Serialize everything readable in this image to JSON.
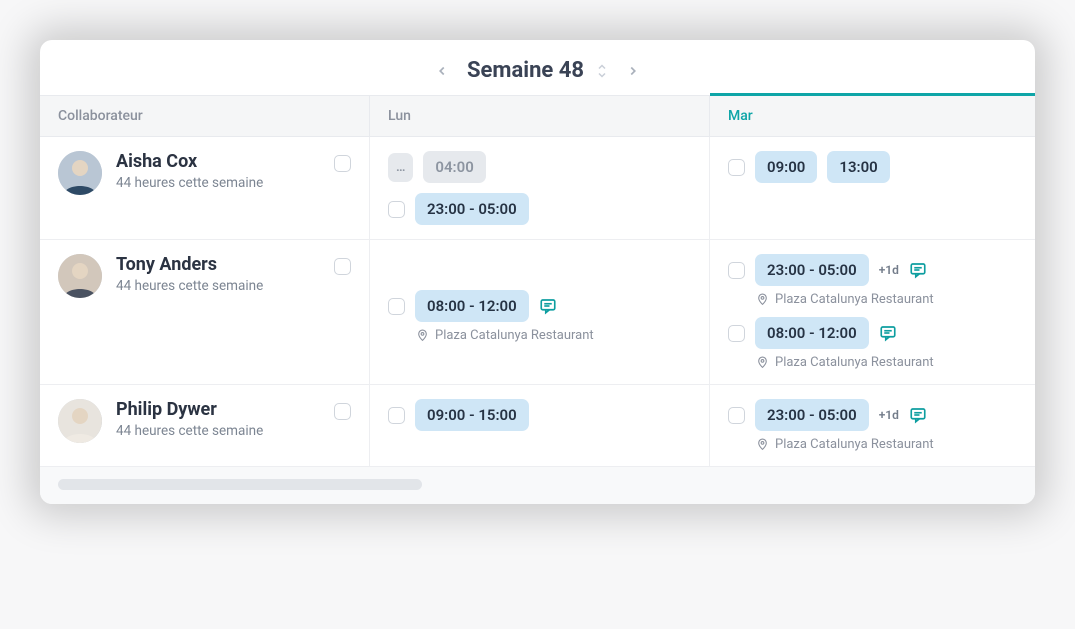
{
  "header": {
    "title": "Semaine 48"
  },
  "columns": {
    "collab": "Collaborateur",
    "mon": "Lun",
    "tue": "Mar"
  },
  "rows": [
    {
      "name": "Aisha Cox",
      "sub": "44 heures cette semaine",
      "mon": [
        {
          "ellipsis": "…",
          "time": "04:00",
          "muted": true
        },
        {
          "check": true,
          "time": "23:00 - 05:00"
        }
      ],
      "tue": [
        {
          "check": true,
          "time1": "09:00",
          "time2": "13:00"
        }
      ]
    },
    {
      "name": "Tony Anders",
      "sub": "44 heures cette semaine",
      "mon": [
        {
          "check": true,
          "time": "08:00 - 12:00",
          "comment": true,
          "location": "Plaza Catalunya Restaurant"
        }
      ],
      "tue": [
        {
          "check": true,
          "time": "23:00 - 05:00",
          "badge": "+1d",
          "comment": true,
          "location": "Plaza Catalunya Restaurant"
        },
        {
          "check": true,
          "time": "08:00 - 12:00",
          "comment": true,
          "location": "Plaza Catalunya Restaurant"
        }
      ]
    },
    {
      "name": "Philip Dywer",
      "sub": "44 heures cette semaine",
      "mon": [
        {
          "check": true,
          "time": "09:00 - 15:00"
        }
      ],
      "tue": [
        {
          "check": true,
          "time": "23:00 - 05:00",
          "badge": "+1d",
          "comment": true,
          "location": "Plaza Catalunya Restaurant"
        }
      ]
    }
  ]
}
